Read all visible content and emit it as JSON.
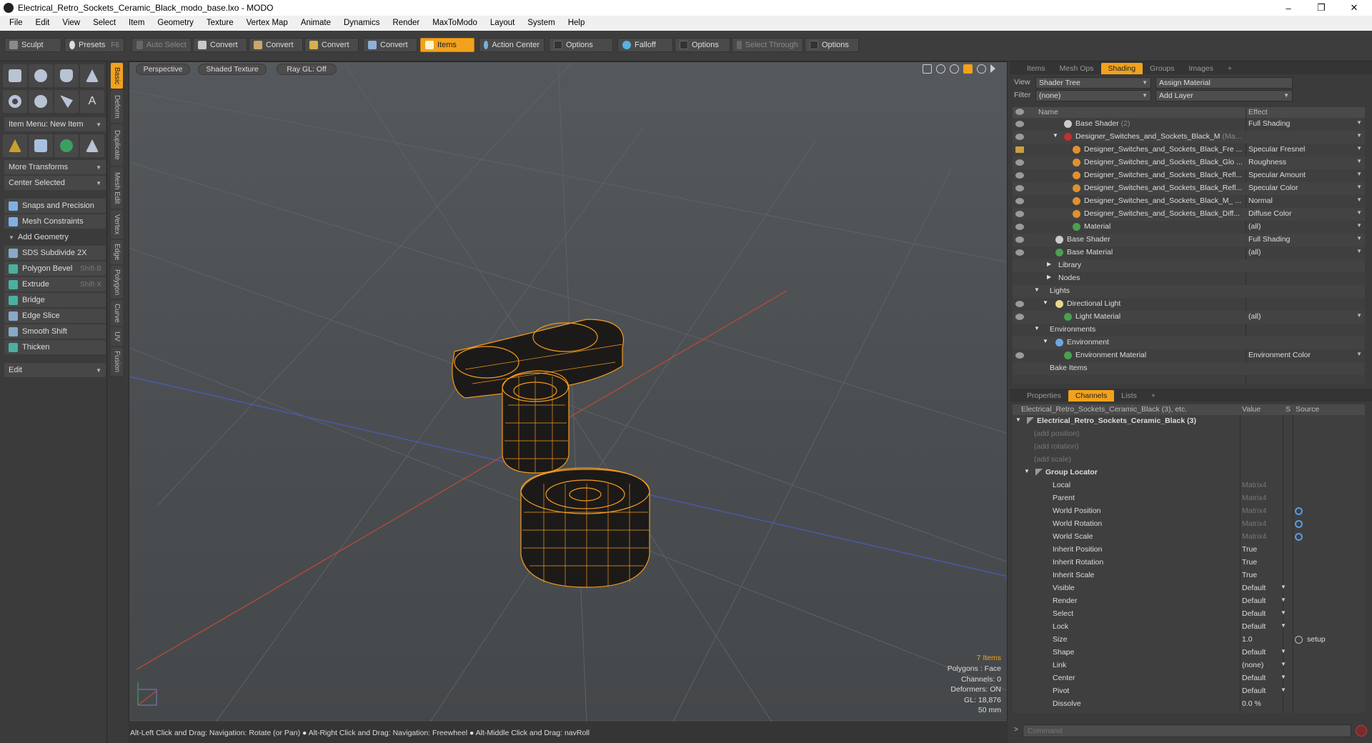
{
  "window": {
    "title": "Electrical_Retro_Sockets_Ceramic_Black_modo_base.lxo - MODO"
  },
  "menu": [
    "File",
    "Edit",
    "View",
    "Select",
    "Item",
    "Geometry",
    "Texture",
    "Vertex Map",
    "Animate",
    "Dynamics",
    "Render",
    "MaxToModo",
    "Layout",
    "System",
    "Help"
  ],
  "toolbar": {
    "sculpt": "Sculpt",
    "presets": "Presets",
    "presets_key": "F6",
    "auto_select": "Auto Select",
    "convert": "Convert",
    "items": "Items",
    "action_center": "Action Center",
    "options": "Options",
    "falloff": "Falloff",
    "select_through": "Select Through"
  },
  "left": {
    "item_menu": "Item Menu: New Item",
    "more_transforms": "More Transforms",
    "center_selected": "Center Selected",
    "snaps": "Snaps and Precision",
    "mesh_constraints": "Mesh Constraints",
    "add_geometry": "Add Geometry",
    "tools": [
      {
        "label": "SDS Subdivide 2X",
        "key": ""
      },
      {
        "label": "Polygon Bevel",
        "key": "Shift-B"
      },
      {
        "label": "Extrude",
        "key": "Shift-X"
      },
      {
        "label": "Bridge",
        "key": ""
      },
      {
        "label": "Edge Slice",
        "key": ""
      },
      {
        "label": "Smooth Shift",
        "key": ""
      },
      {
        "label": "Thicken",
        "key": ""
      }
    ],
    "edit": "Edit",
    "vtabs": [
      "Basic",
      "Deform",
      "Duplicate",
      "Mesh Edit",
      "Vertex",
      "Edge",
      "Polygon",
      "Curve",
      "UV",
      "Fusion"
    ]
  },
  "viewport": {
    "view_mode": "Perspective",
    "shading": "Shaded Texture",
    "raygl": "Ray GL: Off",
    "stats": {
      "items": "7 Items",
      "polygons": "Polygons : Face",
      "channels": "Channels: 0",
      "deformers": "Deformers: ON",
      "gl": "GL: 18,876",
      "scale": "50 mm"
    }
  },
  "status": "Alt-Left Click and Drag: Navigation: Rotate (or Pan) ●  Alt-Right Click and Drag: Navigation: Freewheel ●  Alt-Middle Click and Drag: navRoll",
  "shading_panel": {
    "tabs": [
      "Items",
      "Mesh Ops",
      "Shading",
      "Groups",
      "Images",
      "+"
    ],
    "view_label": "View",
    "view_value": "Shader Tree",
    "assign": "Assign Material",
    "filter_label": "Filter",
    "filter_value": "(none)",
    "add_layer": "Add Layer",
    "col_name": "Name",
    "col_effect": "Effect",
    "rows": [
      {
        "name": "Base Shader",
        "suffix": "(2)",
        "effect": "Full Shading"
      },
      {
        "name": "Designer_Switches_and_Sockets_Black_M",
        "suffix": "(Ma...",
        "effect": ""
      },
      {
        "name": "Designer_Switches_and_Sockets_Black_Fre ...",
        "suffix": "",
        "effect": "Specular Fresnel"
      },
      {
        "name": "Designer_Switches_and_Sockets_Black_Glo ...",
        "suffix": "",
        "effect": "Roughness"
      },
      {
        "name": "Designer_Switches_and_Sockets_Black_Refl...",
        "suffix": "",
        "effect": "Specular Amount"
      },
      {
        "name": "Designer_Switches_and_Sockets_Black_Refl...",
        "suffix": "",
        "effect": "Specular Color"
      },
      {
        "name": "Designer_Switches_and_Sockets_Black_M_ ...",
        "suffix": "",
        "effect": "Normal"
      },
      {
        "name": "Designer_Switches_and_Sockets_Black_Diff...",
        "suffix": "",
        "effect": "Diffuse Color"
      },
      {
        "name": "Material",
        "suffix": "",
        "effect": "(all)"
      },
      {
        "name": "Base Shader",
        "suffix": "",
        "effect": "Full Shading"
      },
      {
        "name": "Base Material",
        "suffix": "",
        "effect": "(all)"
      },
      {
        "name": "Library",
        "suffix": "",
        "effect": ""
      },
      {
        "name": "Nodes",
        "suffix": "",
        "effect": ""
      },
      {
        "name": "Lights",
        "suffix": "",
        "effect": ""
      },
      {
        "name": "Directional Light",
        "suffix": "",
        "effect": ""
      },
      {
        "name": "Light Material",
        "suffix": "",
        "effect": "(all)"
      },
      {
        "name": "Environments",
        "suffix": "",
        "effect": ""
      },
      {
        "name": "Environment",
        "suffix": "",
        "effect": ""
      },
      {
        "name": "Environment Material",
        "suffix": "",
        "effect": "Environment Color"
      },
      {
        "name": "Bake Items",
        "suffix": "",
        "effect": ""
      }
    ]
  },
  "channels_panel": {
    "tabs": [
      "Properties",
      "Channels",
      "Lists",
      "+"
    ],
    "header": "Electrical_Retro_Sockets_Ceramic_Black (3), etc.",
    "col_value": "Value",
    "col_s": "S",
    "col_source": "Source",
    "root": "Electrical_Retro_Sockets_Ceramic_Black (3)",
    "add_rows": [
      "(add position)",
      "(add rotation)",
      "(add scale)"
    ],
    "group": "Group Locator",
    "rows": [
      {
        "name": "Local",
        "value": "Matrix4",
        "source": ""
      },
      {
        "name": "Parent",
        "value": "Matrix4",
        "source": ""
      },
      {
        "name": "World Position",
        "value": "Matrix4",
        "source": ""
      },
      {
        "name": "World Rotation",
        "value": "Matrix4",
        "source": ""
      },
      {
        "name": "World Scale",
        "value": "Matrix4",
        "source": ""
      },
      {
        "name": "Inherit Position",
        "value": "True",
        "source": ""
      },
      {
        "name": "Inherit Rotation",
        "value": "True",
        "source": ""
      },
      {
        "name": "Inherit Scale",
        "value": "True",
        "source": ""
      },
      {
        "name": "Visible",
        "value": "Default",
        "source": ""
      },
      {
        "name": "Render",
        "value": "Default",
        "source": ""
      },
      {
        "name": "Select",
        "value": "Default",
        "source": ""
      },
      {
        "name": "Lock",
        "value": "Default",
        "source": ""
      },
      {
        "name": "Size",
        "value": "1.0",
        "source": "setup"
      },
      {
        "name": "Shape",
        "value": "Default",
        "source": ""
      },
      {
        "name": "Link",
        "value": "(none)",
        "source": ""
      },
      {
        "name": "Center",
        "value": "Default",
        "source": ""
      },
      {
        "name": "Pivot",
        "value": "Default",
        "source": ""
      },
      {
        "name": "Dissolve",
        "value": "0.0 %",
        "source": ""
      }
    ],
    "command_placeholder": "Command"
  },
  "colors": {
    "accent": "#f2a21c",
    "wire": "#f39a1e",
    "x_axis": "#c04a3a",
    "z_axis": "#4a5ab0"
  }
}
